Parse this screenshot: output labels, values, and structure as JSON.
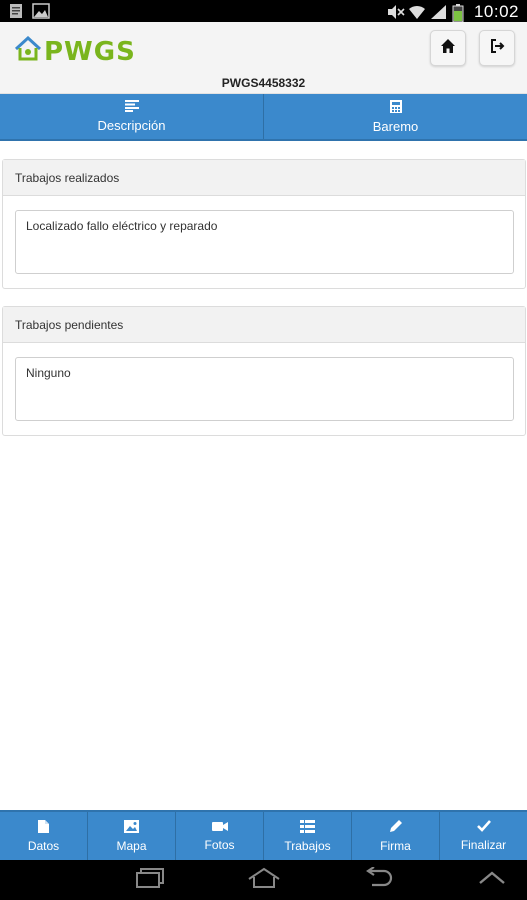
{
  "status_bar": {
    "time": "10:02",
    "icons": [
      "document-icon",
      "image-icon",
      "mute-icon",
      "wifi-icon",
      "signal-icon",
      "battery-icon"
    ]
  },
  "header": {
    "logo_text": "PWGS",
    "reference": "PWGS4458332",
    "colors": {
      "logo": "#7ab51d"
    }
  },
  "tabs": [
    {
      "label": "Descripción",
      "icon": "list-icon"
    },
    {
      "label": "Baremo",
      "icon": "calculator-icon"
    }
  ],
  "panels": {
    "done": {
      "title": "Trabajos realizados",
      "value": "Localizado fallo eléctrico y reparado"
    },
    "pending": {
      "title": "Trabajos pendientes",
      "value": "Ninguno"
    }
  },
  "bottom_nav": [
    {
      "label": "Datos",
      "icon": "file-icon"
    },
    {
      "label": "Mapa",
      "icon": "picture-icon"
    },
    {
      "label": "Fotos",
      "icon": "video-camera-icon"
    },
    {
      "label": "Trabajos",
      "icon": "list-icon"
    },
    {
      "label": "Firma",
      "icon": "pencil-icon"
    },
    {
      "label": "Finalizar",
      "icon": "check-icon"
    }
  ],
  "theme": {
    "accent": "#3b89cc"
  }
}
